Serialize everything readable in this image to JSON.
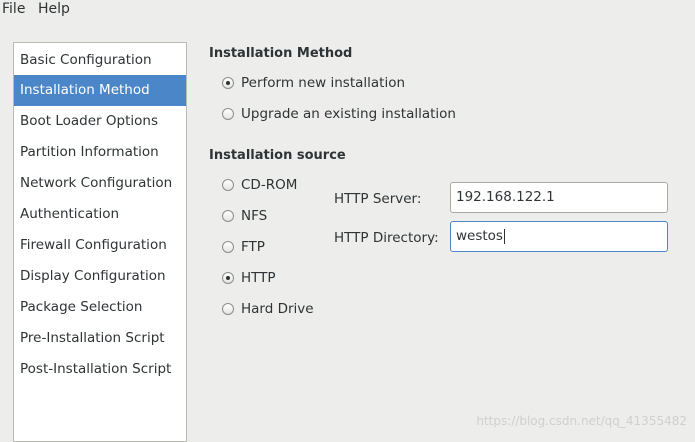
{
  "menubar": {
    "file": "File",
    "help": "Help"
  },
  "sidebar": {
    "items": [
      {
        "label": "Basic Configuration"
      },
      {
        "label": "Installation Method"
      },
      {
        "label": "Boot Loader Options"
      },
      {
        "label": "Partition Information"
      },
      {
        "label": "Network Configuration"
      },
      {
        "label": "Authentication"
      },
      {
        "label": "Firewall Configuration"
      },
      {
        "label": "Display Configuration"
      },
      {
        "label": "Package Selection"
      },
      {
        "label": "Pre-Installation Script"
      },
      {
        "label": "Post-Installation Script"
      }
    ],
    "selected": "Installation Method"
  },
  "install_method": {
    "title": "Installation Method",
    "options": [
      "Perform new installation",
      "Upgrade an existing installation"
    ],
    "selected": "Perform new installation"
  },
  "install_source": {
    "title": "Installation source",
    "options": [
      "CD-ROM",
      "NFS",
      "FTP",
      "HTTP",
      "Hard Drive"
    ],
    "selected": "HTTP"
  },
  "http": {
    "server_label": "HTTP Server:",
    "server_value": "192.168.122.1",
    "directory_label": "HTTP Directory:",
    "directory_value": "westos"
  },
  "watermark": "https://blog.csdn.net/qq_41355482",
  "colors": {
    "selection": "#4a86c8",
    "window_bg": "#ededec"
  }
}
